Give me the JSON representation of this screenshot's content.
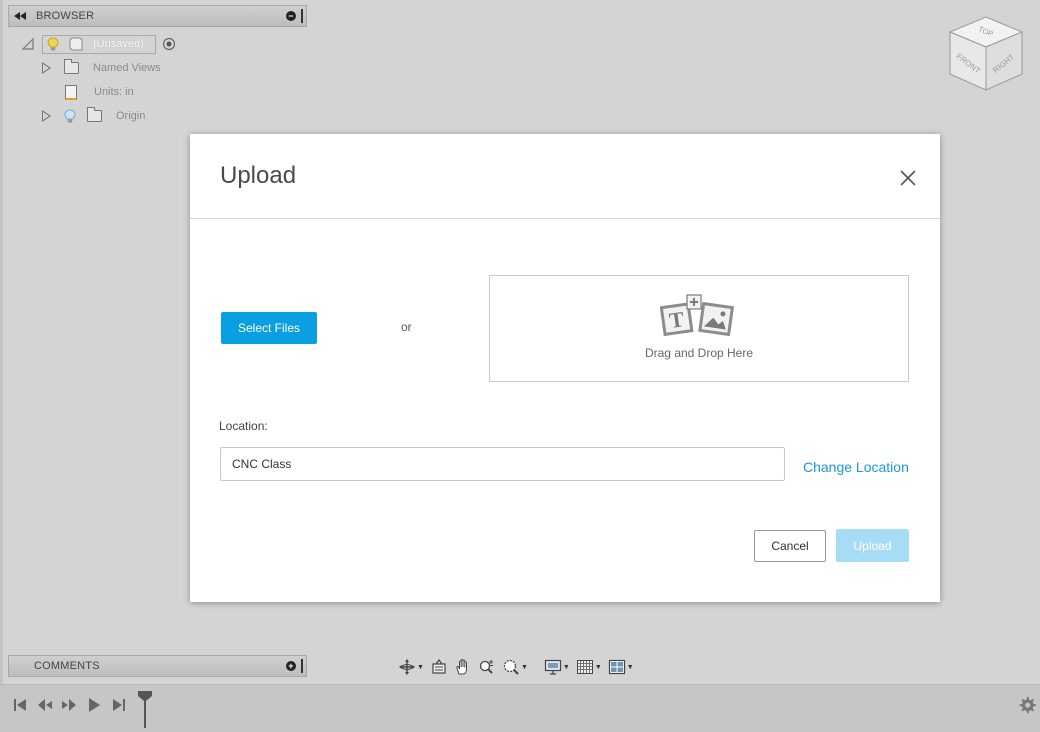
{
  "browser": {
    "title": "BROWSER",
    "root_label": "(Unsaved)",
    "items": [
      {
        "label": "Named Views",
        "icon": "folder-icon"
      },
      {
        "label": "Units: in",
        "icon": "document-icon"
      },
      {
        "label": "Origin",
        "icon": "folder-icon"
      }
    ]
  },
  "comments": {
    "title": "COMMENTS"
  },
  "viewcube": {
    "top": "TOP",
    "front": "FRONT",
    "right": "RIGHT"
  },
  "dialog": {
    "title": "Upload",
    "select_files_label": "Select Files",
    "or_text": "or",
    "drop_text": "Drag and Drop Here",
    "location_label": "Location:",
    "location_value": "CNC Class",
    "change_location_label": "Change Location",
    "cancel_label": "Cancel",
    "upload_label": "Upload"
  },
  "colors": {
    "accent": "#0a9fe0",
    "accent_disabled": "#a6ddf5",
    "link": "#1b9ad6",
    "canvas_bg": "#d4d4d4"
  },
  "nav_toolbar": [
    "orbit-icon",
    "look-at-icon",
    "pan-hand-icon",
    "zoom-icon",
    "fit-zoom-icon",
    "display-settings-icon",
    "grid-settings-icon",
    "viewports-icon"
  ],
  "timeline": [
    "first-frame-icon",
    "previous-step-icon",
    "play-icon",
    "next-step-icon",
    "last-frame-icon",
    "timeline-marker-icon",
    "settings-gear-icon"
  ]
}
